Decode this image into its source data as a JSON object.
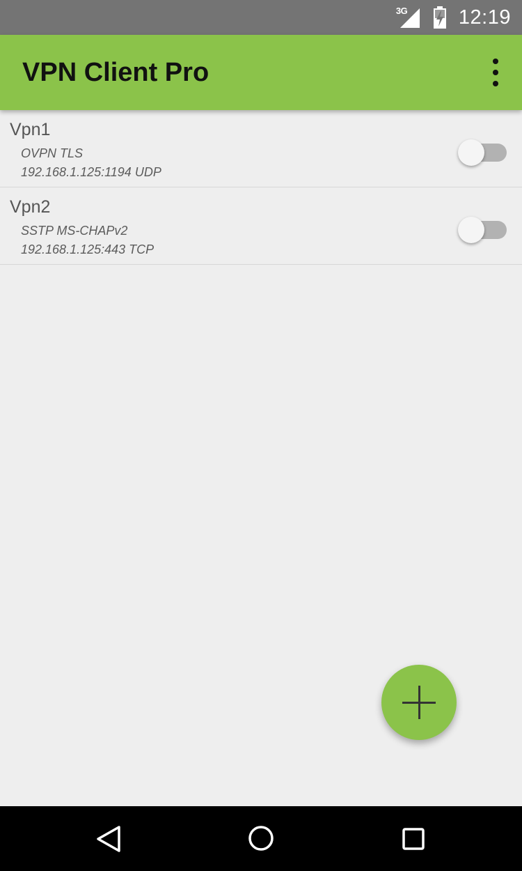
{
  "status_bar": {
    "network_label": "3G",
    "time": "12:19",
    "icons": [
      "signal-icon",
      "battery-icon"
    ]
  },
  "app_bar": {
    "title": "VPN Client Pro",
    "menu_icon": "more-vert-icon",
    "color": "#8bc34a"
  },
  "vpn_list": [
    {
      "name": "Vpn1",
      "protocol": "OVPN TLS",
      "endpoint": "192.168.1.125:1194 UDP",
      "enabled": false
    },
    {
      "name": "Vpn2",
      "protocol": "SSTP MS-CHAPv2",
      "endpoint": "192.168.1.125:443 TCP",
      "enabled": false
    }
  ],
  "fab": {
    "icon": "plus-icon",
    "color": "#8bc34a"
  },
  "nav_bar": {
    "buttons": [
      "back-icon",
      "home-icon",
      "recents-icon"
    ]
  }
}
